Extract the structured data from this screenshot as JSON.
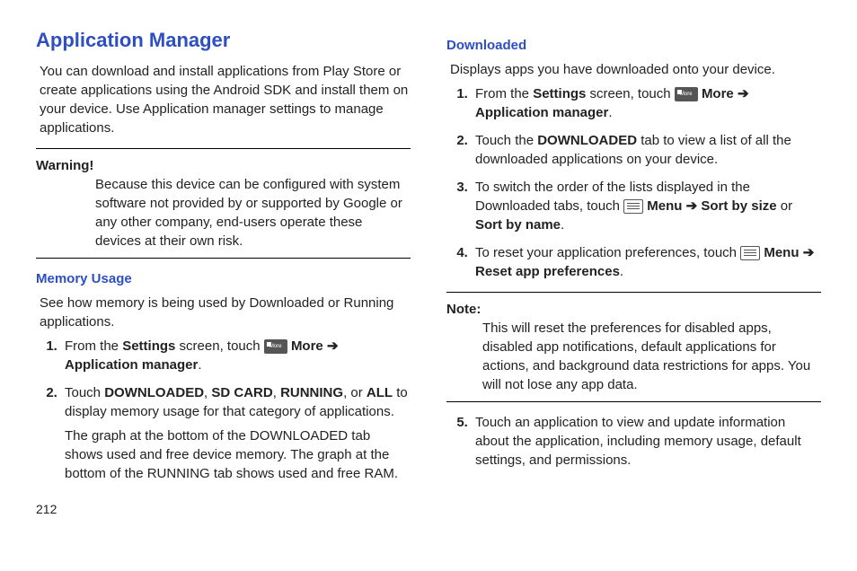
{
  "pageNumber": "212",
  "left": {
    "title": "Application Manager",
    "intro": "You can download and install applications from Play Store or create applications using the Android SDK and install them on your device. Use Application manager settings to manage applications.",
    "warningLabel": "Warning!",
    "warningText": "Because this device can be configured with system software not provided by or supported by Google or any other company, end-users operate these devices at their own risk.",
    "subhead": "Memory Usage",
    "subintro": "See how memory is being used by Downloaded or Running applications.",
    "step1_a": "From the ",
    "step1_b": "Settings",
    "step1_c": " screen, touch ",
    "step1_more": "More",
    "step1_arrow": "➔",
    "step1_d": "Application manager",
    "step1_e": ".",
    "step2_a": "Touch ",
    "step2_b": "DOWNLOADED",
    "step2_c": ", ",
    "step2_d": "SD CARD",
    "step2_e": ", ",
    "step2_f": "RUNNING",
    "step2_g": ", or ",
    "step2_h": "ALL",
    "step2_i": " to display memory usage for that category of applications.",
    "step2_extra": "The graph at the bottom of the DOWNLOADED tab shows used and free device memory. The graph at the bottom of the RUNNING tab shows used and free RAM."
  },
  "right": {
    "subhead": "Downloaded",
    "intro": "Displays apps you have downloaded onto your device.",
    "step1_a": "From the ",
    "step1_b": "Settings",
    "step1_c": " screen, touch ",
    "step1_more": "More",
    "step1_arrow": "➔",
    "step1_d": "Application manager",
    "step1_e": ".",
    "step2_a": "Touch the ",
    "step2_b": "DOWNLOADED",
    "step2_c": " tab to view a list of all the downloaded applications on your device.",
    "step3_a": "To switch the order of the lists displayed in the Downloaded tabs, touch ",
    "step3_menu": "Menu",
    "step3_arrow": "➔",
    "step3_b": "Sort by size",
    "step3_c": " or ",
    "step3_d": "Sort by name",
    "step3_e": ".",
    "step4_a": "To reset your application preferences, touch ",
    "step4_menu": "Menu",
    "step4_arrow": "➔",
    "step4_b": "Reset app preferences",
    "step4_c": ".",
    "noteLabel": "Note:",
    "noteText": "This will reset the preferences for disabled apps, disabled app notifications, default applications for actions, and background data restrictions for apps. You will not lose any app data.",
    "step5": "Touch an application to view and update information about the application, including memory usage, default settings, and permissions."
  }
}
